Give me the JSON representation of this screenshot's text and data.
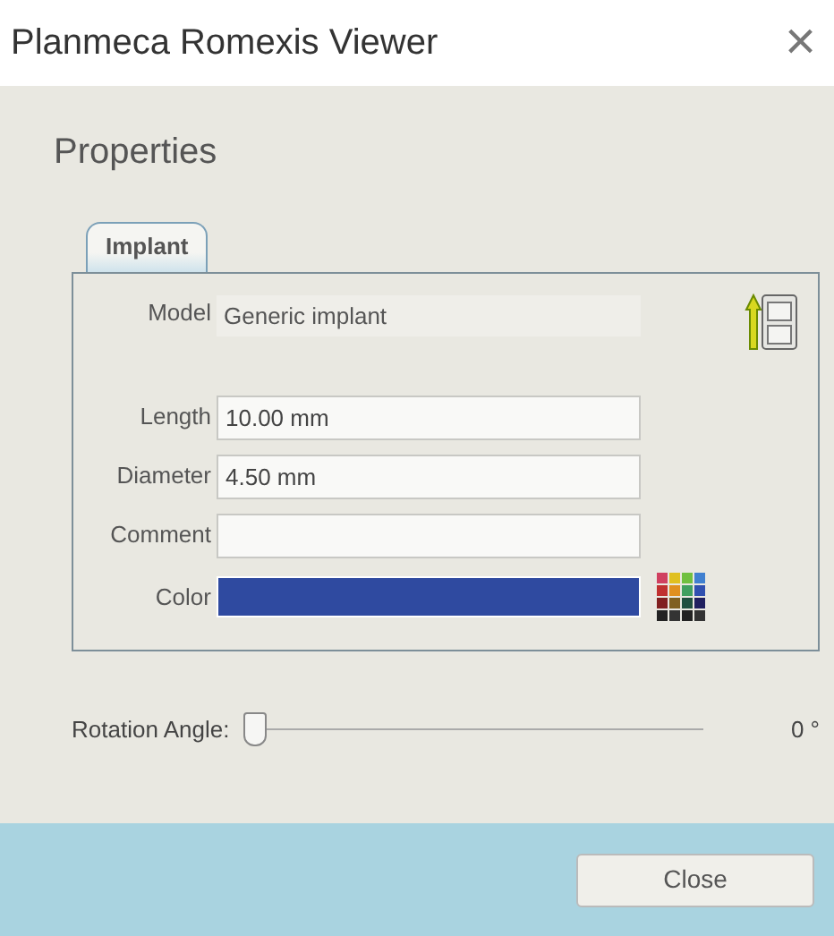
{
  "window": {
    "title": "Planmeca Romexis Viewer",
    "close_glyph": "×"
  },
  "heading": "Properties",
  "tabs": [
    {
      "label": "Implant",
      "selected": true
    }
  ],
  "model": {
    "label": "Model",
    "value": "Generic implant"
  },
  "fields": [
    {
      "label": "Length",
      "value": "10.00 mm"
    },
    {
      "label": "Diameter",
      "value": "4.50 mm"
    },
    {
      "label": "Comment"
    }
  ],
  "color": {
    "label": "Color",
    "color": "#2f4aa0"
  },
  "rotation": {
    "label": "Rotation Angle:",
    "level": 0,
    "reading": "0 °"
  },
  "buttons": [
    "Close"
  ]
}
